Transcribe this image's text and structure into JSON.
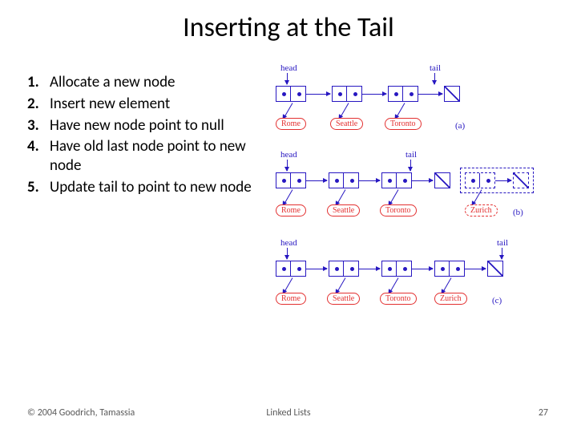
{
  "title": "Inserting at the Tail",
  "steps": [
    "Allocate a new node",
    "Insert new element",
    "Have new node point to null",
    "Have old last node point to new node",
    "Update tail to point to new node"
  ],
  "footer": {
    "copyright": "© 2004 Goodrich, Tamassia",
    "center": "Linked Lists",
    "slide": "27"
  },
  "diagram": {
    "labels": {
      "head": "head",
      "tail": "tail"
    },
    "rows": {
      "a": {
        "tag": "(a)",
        "cities": [
          "Rome",
          "Seattle",
          "Toronto"
        ]
      },
      "b": {
        "tag": "(b)",
        "cities": [
          "Rome",
          "Seattle",
          "Toronto",
          "Zurich"
        ]
      },
      "c": {
        "tag": "(c)",
        "cities": [
          "Rome",
          "Seattle",
          "Toronto",
          "Zurich"
        ]
      }
    }
  }
}
